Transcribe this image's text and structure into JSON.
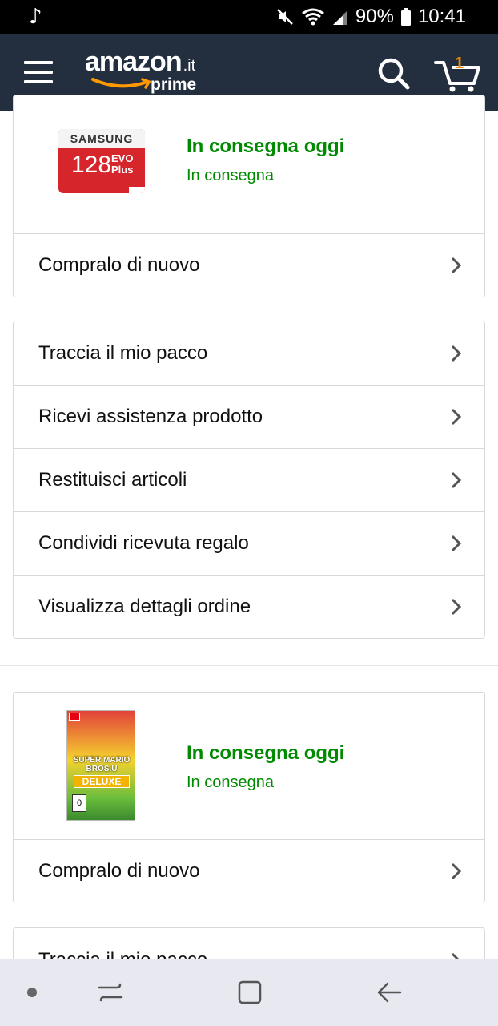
{
  "status_bar": {
    "battery_percent": "90%",
    "time": "10:41"
  },
  "header": {
    "logo_word": "amazon",
    "logo_tld": ".it",
    "logo_sub": "prime",
    "cart_count": "1"
  },
  "order1": {
    "image_brand": "SAMSUNG",
    "image_capacity": "128",
    "image_model": "EVO",
    "image_model_sub": "Plus",
    "delivery_status": "In consegna oggi",
    "delivery_substatus": "In consegna",
    "buy_again": "Compralo di nuovo"
  },
  "actions1": [
    {
      "label": "Traccia il mio pacco"
    },
    {
      "label": "Ricevi assistenza prodotto"
    },
    {
      "label": "Restituisci articoli"
    },
    {
      "label": "Condividi ricevuta regalo"
    },
    {
      "label": "Visualizza dettagli ordine"
    }
  ],
  "order2": {
    "image_title": "SUPER MARIO BROS.U",
    "image_edition": "DELUXE",
    "image_rating": "0",
    "delivery_status": "In consegna oggi",
    "delivery_substatus": "In consegna",
    "buy_again": "Compralo di nuovo"
  },
  "actions2_partial": {
    "label": "Traccia il mio pacco"
  },
  "colors": {
    "header_bg": "#232f3e",
    "delivery_green": "#008a00",
    "cart_badge": "#f08804",
    "smile_orange": "#ff9900"
  }
}
